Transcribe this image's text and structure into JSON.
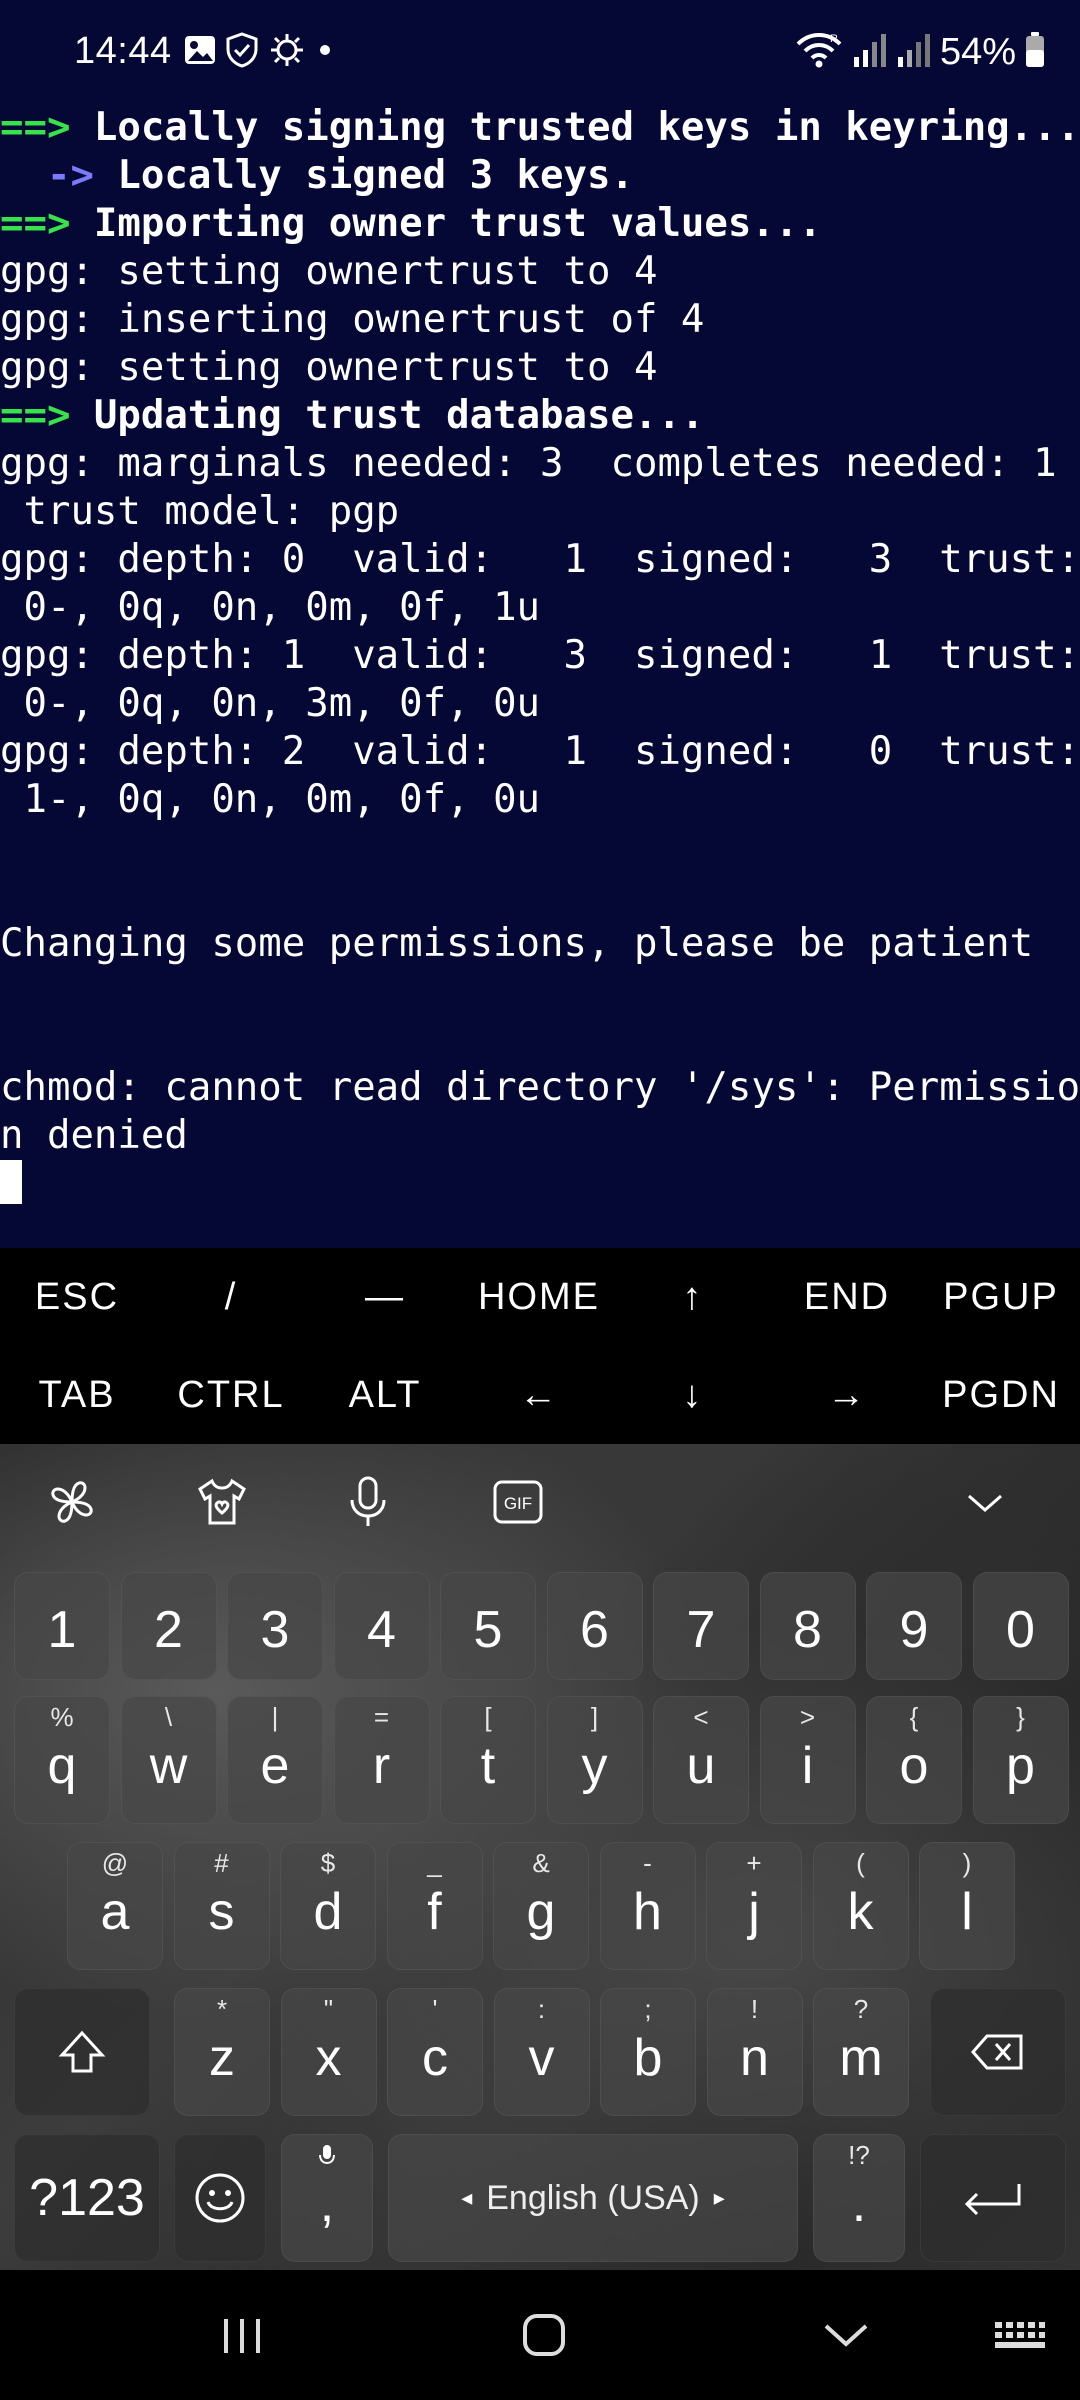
{
  "status": {
    "time": "14:44",
    "battery": "54%",
    "icons": [
      "image-icon",
      "shield-check-icon",
      "virus-shield-icon",
      "dot-icon",
      "wifi-icon",
      "signal-icon",
      "signal-weak-icon",
      "battery-icon"
    ]
  },
  "terminal": {
    "lines": [
      {
        "arrow": "==>",
        "text": " Locally signing trusted keys in keyring..."
      },
      {
        "arrow": "  ->",
        "text": " Locally signed 3 keys."
      },
      {
        "arrow": "==>",
        "text": " Importing owner trust values..."
      },
      {
        "text": "gpg: setting ownertrust to 4"
      },
      {
        "text": "gpg: inserting ownertrust of 4"
      },
      {
        "text": "gpg: setting ownertrust to 4"
      },
      {
        "arrow": "==>",
        "text": " Updating trust database..."
      },
      {
        "text": "gpg: marginals needed: 3  completes needed: 1"
      },
      {
        "text": " trust model: pgp"
      },
      {
        "text": "gpg: depth: 0  valid:   1  signed:   3  trust:"
      },
      {
        "text": " 0-, 0q, 0n, 0m, 0f, 1u"
      },
      {
        "text": "gpg: depth: 1  valid:   3  signed:   1  trust:"
      },
      {
        "text": " 0-, 0q, 0n, 3m, 0f, 0u"
      },
      {
        "text": "gpg: depth: 2  valid:   1  signed:   0  trust:"
      },
      {
        "text": " 1-, 0q, 0n, 0m, 0f, 0u"
      },
      {
        "text": ""
      },
      {
        "text": ""
      },
      {
        "text": "Changing some permissions, please be patient"
      },
      {
        "text": ""
      },
      {
        "text": ""
      },
      {
        "text": "chmod: cannot read directory '/sys': Permissio"
      },
      {
        "text": "n denied"
      }
    ]
  },
  "extra_keys": {
    "row1": [
      "ESC",
      "/",
      "—",
      "HOME",
      "↑",
      "END",
      "PGUP"
    ],
    "row2": [
      "TAB",
      "CTRL",
      "ALT",
      "←",
      "↓",
      "→",
      "PGDN"
    ]
  },
  "keyboard": {
    "toolbar": [
      "settings-icon",
      "theme-icon",
      "mic-icon",
      "gif-icon",
      "collapse-chevron-icon"
    ],
    "gif_label": "GIF",
    "numbers": [
      "1",
      "2",
      "3",
      "4",
      "5",
      "6",
      "7",
      "8",
      "9",
      "0"
    ],
    "row_q": [
      {
        "main": "q",
        "sub": "%"
      },
      {
        "main": "w",
        "sub": "\\"
      },
      {
        "main": "e",
        "sub": "|"
      },
      {
        "main": "r",
        "sub": "="
      },
      {
        "main": "t",
        "sub": "["
      },
      {
        "main": "y",
        "sub": "]"
      },
      {
        "main": "u",
        "sub": "<"
      },
      {
        "main": "i",
        "sub": ">"
      },
      {
        "main": "o",
        "sub": "{"
      },
      {
        "main": "p",
        "sub": "}"
      }
    ],
    "row_a": [
      {
        "main": "a",
        "sub": "@"
      },
      {
        "main": "s",
        "sub": "#"
      },
      {
        "main": "d",
        "sub": "$"
      },
      {
        "main": "f",
        "sub": "_"
      },
      {
        "main": "g",
        "sub": "&"
      },
      {
        "main": "h",
        "sub": "-"
      },
      {
        "main": "j",
        "sub": "+"
      },
      {
        "main": "k",
        "sub": "("
      },
      {
        "main": "l",
        "sub": ")"
      }
    ],
    "row_z": [
      {
        "main": "z",
        "sub": "*"
      },
      {
        "main": "x",
        "sub": "\""
      },
      {
        "main": "c",
        "sub": "'"
      },
      {
        "main": "v",
        "sub": ":"
      },
      {
        "main": "b",
        "sub": ";"
      },
      {
        "main": "n",
        "sub": "!"
      },
      {
        "main": "m",
        "sub": "?"
      }
    ],
    "symbols_label": "?123",
    "comma": ",",
    "space_label": "English (USA)",
    "period": ".",
    "period_sub": "!?"
  },
  "nav": [
    "recents-icon",
    "home-icon",
    "back-icon",
    "keyboard-switch-icon"
  ]
}
